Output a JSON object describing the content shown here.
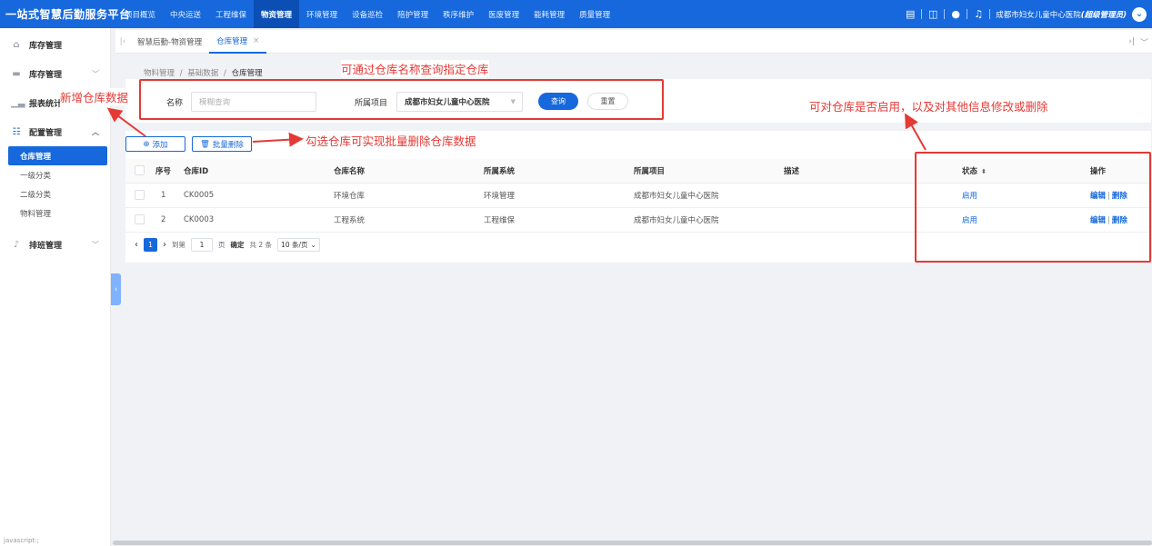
{
  "app": {
    "title": "一站式智慧后勤服务平台"
  },
  "topnav": [
    "项目概览",
    "中央运送",
    "工程维保",
    "物资管理",
    "环境管理",
    "设备巡检",
    "陪护管理",
    "秩序维护",
    "医废管理",
    "能耗管理",
    "质量管理"
  ],
  "topnav_active": "物资管理",
  "user": {
    "org": "成都市妇女儿童中心医院",
    "role": "(超级管理员)"
  },
  "sidebar": {
    "items": [
      {
        "label": "库存管理",
        "icon": "home-icon"
      },
      {
        "label": "库存管理",
        "icon": "archive-icon"
      },
      {
        "label": "报表统计",
        "icon": "chart-icon"
      },
      {
        "label": "配置管理",
        "icon": "grid-icon"
      }
    ],
    "sub": [
      "仓库管理",
      "一级分类",
      "二级分类",
      "物料管理"
    ],
    "bottom": {
      "label": "排班管理",
      "icon": "bell-icon"
    },
    "status_text": "javascript:;"
  },
  "tabs": [
    {
      "label": "智慧后勤-物资管理"
    },
    {
      "label": "仓库管理",
      "close": "×"
    }
  ],
  "breadcrumb": {
    "a": "物料管理",
    "b": "基础数据",
    "c": "仓库管理",
    "sep": "/"
  },
  "search": {
    "name_label": "名称",
    "name_placeholder": "模糊查询",
    "project_label": "所属项目",
    "project_value": "成都市妇女儿童中心医院",
    "query_btn": "查询",
    "reset_btn": "重置"
  },
  "toolbar": {
    "add": "添加",
    "batch_delete": "批量删除"
  },
  "table": {
    "headers": [
      "序号",
      "仓库ID",
      "仓库名称",
      "所属系统",
      "所属项目",
      "描述",
      "状态",
      "操作"
    ],
    "rows": [
      {
        "no": "1",
        "id": "CK0005",
        "name": "环境仓库",
        "system": "环境管理",
        "project": "成都市妇女儿童中心医院",
        "desc": "",
        "status": "启用",
        "edit": "编辑",
        "sep": "|",
        "delete": "删除"
      },
      {
        "no": "2",
        "id": "CK0003",
        "name": "工程系统",
        "system": "工程维保",
        "project": "成都市妇女儿童中心医院",
        "desc": "",
        "status": "启用",
        "edit": "编辑",
        "sep": "|",
        "delete": "删除"
      }
    ]
  },
  "pager": {
    "current": "1",
    "goto": "到第",
    "input": "1",
    "page": "页",
    "confirm": "确定",
    "total": "共 2 条",
    "size": "10 条/页"
  },
  "annotations": {
    "add": "新增仓库数据",
    "search": "可通过仓库名称查询指定仓库",
    "batch": "勾选仓库可实现批量删除仓库数据",
    "status": "可对仓库是否启用，以及对其他信息修改或删除"
  },
  "colors": {
    "brand": "#1668dc",
    "annotation": "#e53935"
  }
}
